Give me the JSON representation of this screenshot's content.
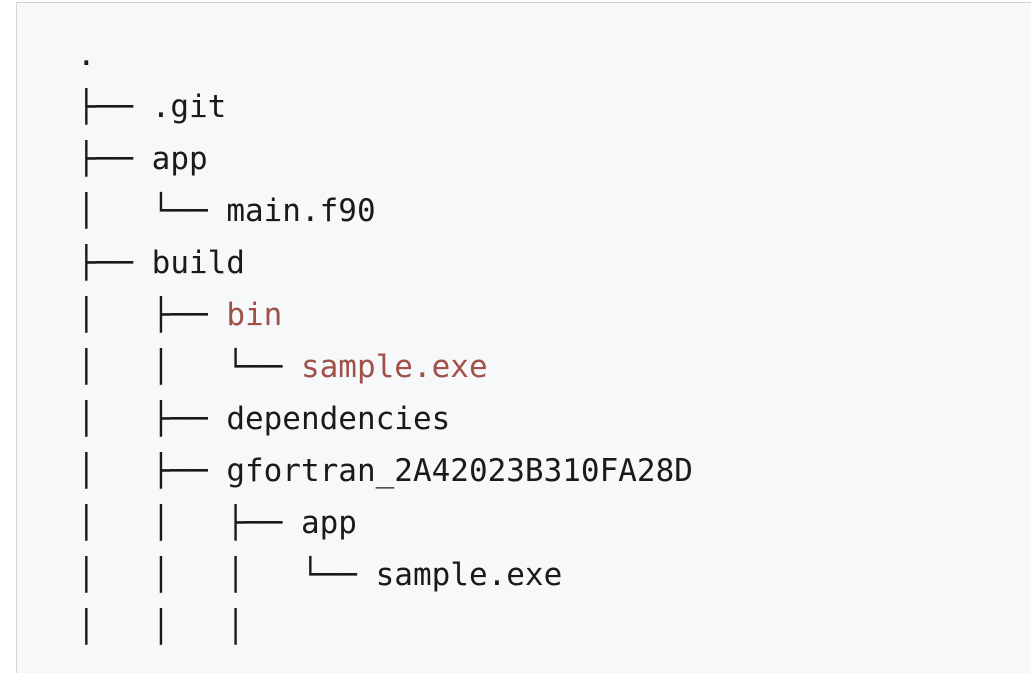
{
  "tree": {
    "lines": [
      {
        "prefix": "",
        "name": ".",
        "kind": "dir"
      },
      {
        "prefix": "├── ",
        "name": ".git",
        "kind": "dir"
      },
      {
        "prefix": "├── ",
        "name": "app",
        "kind": "dir"
      },
      {
        "prefix": "│   └── ",
        "name": "main.f90",
        "kind": "file"
      },
      {
        "prefix": "├── ",
        "name": "build",
        "kind": "dir"
      },
      {
        "prefix": "│   ├── ",
        "name": "bin",
        "kind": "highlight"
      },
      {
        "prefix": "│   │   └── ",
        "name": "sample.exe",
        "kind": "highlight"
      },
      {
        "prefix": "│   ├── ",
        "name": "dependencies",
        "kind": "dir"
      },
      {
        "prefix": "│   ├── ",
        "name": "gfortran_2A42023B310FA28D",
        "kind": "dir"
      },
      {
        "prefix": "│   │   ├── ",
        "name": "app",
        "kind": "dir"
      },
      {
        "prefix": "│   │   │   └── ",
        "name": "sample.exe",
        "kind": "file"
      },
      {
        "prefix": "│   │   │",
        "name": "",
        "kind": "dir"
      }
    ]
  },
  "colors": {
    "highlight": "#a0524a",
    "text": "#1a1a1a",
    "background": "#f6f8fa"
  }
}
